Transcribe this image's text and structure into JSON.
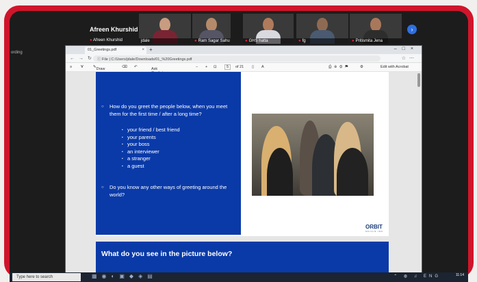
{
  "meeting": {
    "presenter_name": "Afreen Khurshid",
    "participants": [
      {
        "name": "Afreen Khurshid"
      },
      {
        "name": "jdale"
      },
      {
        "name": "Ram Sagar Sahu"
      },
      {
        "name": "GHS hatta"
      },
      {
        "name": "fg"
      },
      {
        "name": "Pritismita Jena"
      }
    ],
    "next_icon": "chevron-right-icon",
    "side_label": "ording"
  },
  "browser": {
    "tab_title": "01_Greetings.pdf",
    "url_prefix": "File",
    "url": "C:/Users/jdale/Downloads/01_%20Greetings.pdf"
  },
  "pdf_toolbar": {
    "draw_label": "Draw",
    "ask_copilot_label": "Ask Copilot",
    "page_current": "5",
    "page_total": "of 21",
    "edit_label": "Edit with Acrobat"
  },
  "slide": {
    "question1": "How do you greet the people below, when you meet them for the first time / after a long time?",
    "subitems": [
      "your friend / best friend",
      "your parents",
      "your boss",
      "an interviewer",
      "a stranger",
      "a guest"
    ],
    "question2": "Do you know any other ways of greeting around the world?",
    "logo_text": "ORBIT",
    "logo_sub": "SKILLS INC"
  },
  "slide2": {
    "heading": "What do you see in the picture below?"
  },
  "taskbar": {
    "search_placeholder": "Type here to search",
    "lang": "ENG",
    "time": "11:14"
  },
  "colors": {
    "frame": "#d0152b",
    "slide_blue": "#0a3aa8"
  }
}
